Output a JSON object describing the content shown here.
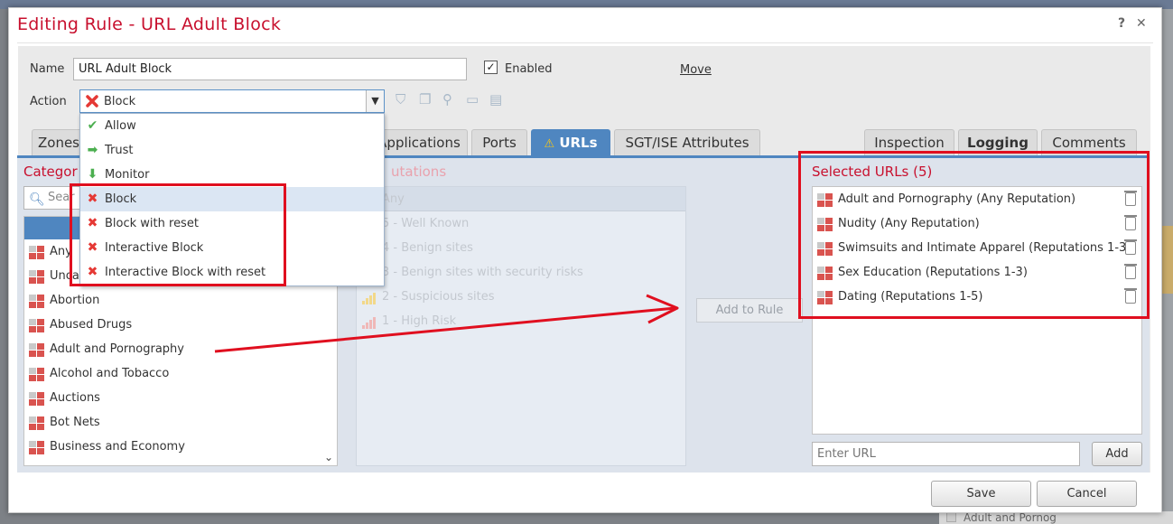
{
  "dialog": {
    "title": "Editing Rule - URL Adult Block",
    "help_icon": "?",
    "close_icon": "✕"
  },
  "form": {
    "name_label": "Name",
    "name_value": "URL Adult Block",
    "enabled_label": "Enabled",
    "enabled_checked": true,
    "move_label": "Move",
    "action_label": "Action",
    "action_value": "Block"
  },
  "action_options": [
    {
      "label": "Allow",
      "icon": "check-icon",
      "color": "#4caf50"
    },
    {
      "label": "Trust",
      "icon": "arrow-right-icon",
      "color": "#4caf50"
    },
    {
      "label": "Monitor",
      "icon": "arrow-down-icon",
      "color": "#4caf50"
    },
    {
      "label": "Block",
      "icon": "x-icon",
      "color": "#e53935"
    },
    {
      "label": "Block with reset",
      "icon": "x-reset-icon",
      "color": "#e53935"
    },
    {
      "label": "Interactive Block",
      "icon": "x-arrow-icon",
      "color": "#e53935"
    },
    {
      "label": "Interactive Block with reset",
      "icon": "x-arrow-reset-icon",
      "color": "#e53935"
    }
  ],
  "tabs": {
    "zones": "Zones",
    "applications": "Applications",
    "ports": "Ports",
    "urls": "URLs",
    "sgt": "SGT/ISE Attributes",
    "inspection": "Inspection",
    "logging": "Logging",
    "comments": "Comments"
  },
  "categories": {
    "title": "Categor",
    "search_placeholder": "Sear",
    "items": [
      "Any",
      "Unca",
      "Abortion",
      "Abused Drugs",
      "Adult and Pornography",
      "Alcohol and Tobacco",
      "Auctions",
      "Bot Nets",
      "Business and Economy"
    ]
  },
  "reputations": {
    "title": "utations",
    "items": [
      "Any",
      "5 - Well Known",
      "4 - Benign sites",
      "3 - Benign sites with security risks",
      "2 - Suspicious sites",
      "1 - High Risk"
    ]
  },
  "add_to_rule_label": "Add to Rule",
  "selected_urls": {
    "title": "Selected URLs (5)",
    "items": [
      "Adult and Pornography (Any Reputation)",
      "Nudity (Any Reputation)",
      "Swimsuits and Intimate Apparel (Reputations 1-3)",
      "Sex Education (Reputations 1-3)",
      "Dating (Reputations 1-5)"
    ]
  },
  "url_input_placeholder": "Enter URL",
  "add_label": "Add",
  "save_label": "Save",
  "cancel_label": "Cancel",
  "background": {
    "bottom_text": "Adult and Pornog"
  },
  "colors": {
    "accent": "#4f86c0",
    "title_red": "#c8102e",
    "annotation_red": "#e00f1f"
  }
}
